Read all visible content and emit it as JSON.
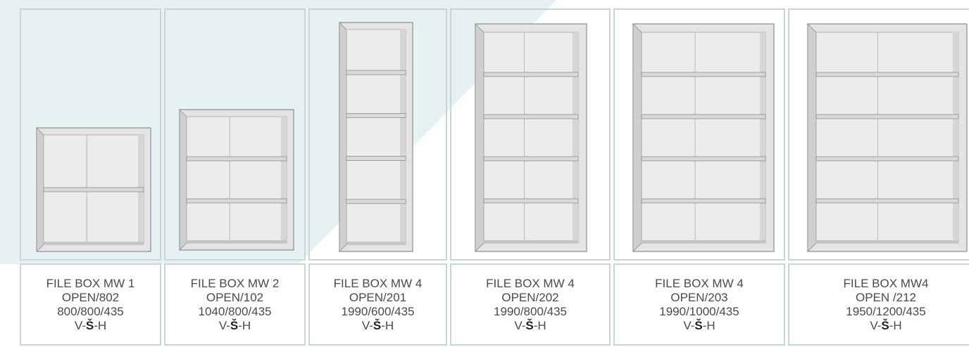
{
  "products": [
    {
      "name": "FILE BOX MW 1",
      "variant": "OPEN/802",
      "dimensions": "800/800/435",
      "code_prefix": "V-",
      "code_bold": "Š",
      "code_suffix": "-H",
      "shelves": 1
    },
    {
      "name": "FILE BOX MW 2",
      "variant": "OPEN/102",
      "dimensions": "1040/800/435",
      "code_prefix": "V-",
      "code_bold": "Š",
      "code_suffix": "-H",
      "shelves": 2
    },
    {
      "name": "FILE BOX MW 4",
      "variant": "OPEN/201",
      "dimensions": "1990/600/435",
      "code_prefix": "V-",
      "code_bold": "Š",
      "code_suffix": "-H",
      "shelves": 4
    },
    {
      "name": "FILE BOX MW 4",
      "variant": "OPEN/202",
      "dimensions": "1990/800/435",
      "code_prefix": "V-",
      "code_bold": "Š",
      "code_suffix": "-H",
      "shelves": 4
    },
    {
      "name": "FILE BOX MW 4",
      "variant": "OPEN/203",
      "dimensions": "1990/1000/435",
      "code_prefix": "V-",
      "code_bold": "Š",
      "code_suffix": "-H",
      "shelves": 4
    },
    {
      "name": "FILE BOX MW4",
      "variant": "OPEN /212",
      "dimensions": "1950/1200/435",
      "code_prefix": "V-",
      "code_bold": "Š",
      "code_suffix": "-H",
      "shelves": 4
    }
  ],
  "colors": {
    "background_tint": "#dbe6e6",
    "highlight_tint": "#e4f1f1",
    "cell_border": "#c9d6d6",
    "cabinet_frame": "#d9d9d9",
    "cabinet_edge": "#8e8e8e",
    "text": "#4a4a4a"
  }
}
